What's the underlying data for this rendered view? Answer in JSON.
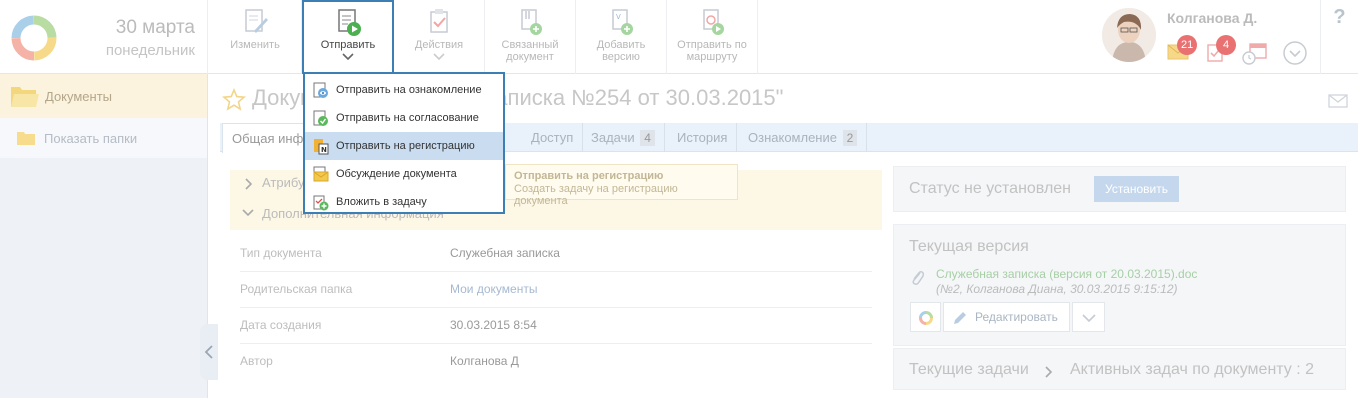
{
  "header": {
    "date_main": "30 марта",
    "date_sub": "понедельник",
    "toolbar": [
      {
        "label": "Изменить",
        "icon": "edit-doc-icon"
      },
      {
        "label": "Отправить",
        "icon": "send-doc-icon"
      },
      {
        "label": "Действия",
        "icon": "actions-icon"
      },
      {
        "label_1": "Связанный",
        "label_2": "документ",
        "icon": "linked-doc-icon"
      },
      {
        "label_1": "Добавить",
        "label_2": "версию",
        "icon": "add-version-icon"
      },
      {
        "label_1": "Отправить по",
        "label_2": "маршруту",
        "icon": "route-icon"
      }
    ],
    "user_name": "Колганова Д.",
    "mail_count": "21",
    "tasks_count": "4",
    "help": "?"
  },
  "sidebar": {
    "items": [
      {
        "label": "Документы",
        "icon": "folder-open-icon"
      },
      {
        "label": "Показать папки",
        "icon": "folder-icon"
      }
    ]
  },
  "document": {
    "title": "Документ \"Служебная записка №254 от 30.03.2015\"",
    "tabs": [
      {
        "label": "Общая информация"
      },
      {
        "label": "Доступ"
      },
      {
        "label": "Задачи",
        "count": "4"
      },
      {
        "label": "История"
      },
      {
        "label": "Ознакомление",
        "count": "2"
      }
    ],
    "sections": {
      "attributes": "Атрибуты",
      "additional": "Дополнительная информация"
    },
    "properties": [
      {
        "key": "Тип документа",
        "value": "Служебная записка"
      },
      {
        "key": "Родительская папка",
        "value": "Мои документы"
      },
      {
        "key": "Дата создания",
        "value": "30.03.2015 8:54"
      },
      {
        "key": "Автор",
        "value": "Колганова Д"
      }
    ]
  },
  "tooltip": {
    "title": "Отправить на регистрацию",
    "text": "Создать задачу на регистрацию документа"
  },
  "right_panel": {
    "status": "Статус не установлен",
    "install_button": "Установить",
    "version_title": "Текущая версия",
    "file_link": "Служебная записка (версия от 20.03.2015).doc",
    "file_meta": "(№2, Колганова Диана, 30.03.2015 9:15:12)",
    "edit_button": "Редактировать",
    "tasks_title": "Текущие задачи",
    "tasks_count": "Активных задач по документу : 2"
  },
  "dropdown": {
    "items": [
      {
        "label": "Отправить на ознакомление",
        "icon": "review-icon"
      },
      {
        "label": "Отправить на согласование",
        "icon": "approve-icon"
      },
      {
        "label": "Отправить на регистрацию",
        "icon": "register-icon"
      },
      {
        "label": "Обсуждение документа",
        "icon": "discussion-icon"
      },
      {
        "label": "Вложить в задачу",
        "icon": "attach-task-icon"
      }
    ]
  },
  "colors": {
    "accent_border": "#3b7fb5",
    "highlight": "#c9dcf0",
    "badge": "#e97171",
    "link_green": "#a7cfa5"
  }
}
